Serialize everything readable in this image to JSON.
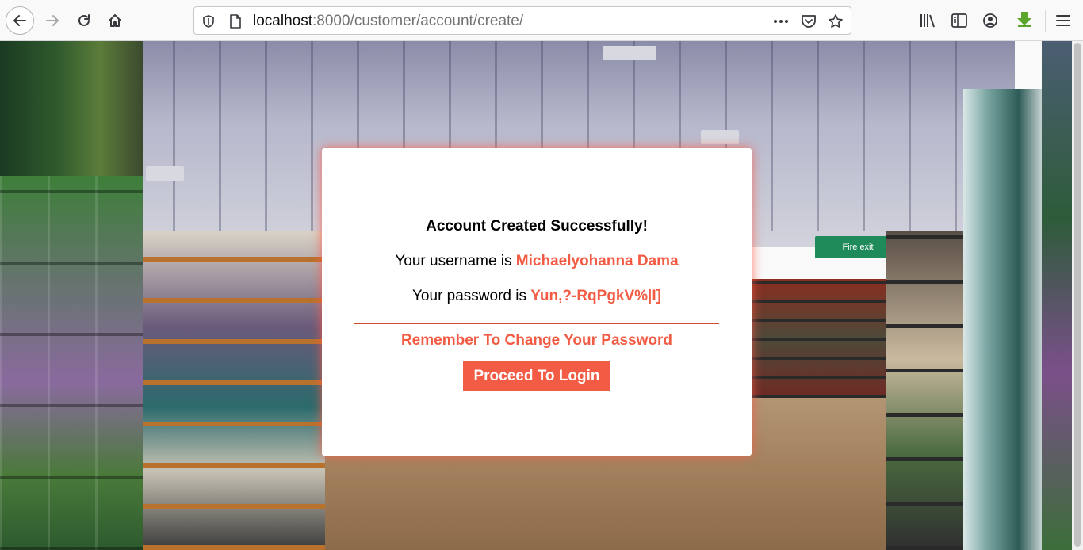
{
  "browser": {
    "url_host": "localhost",
    "url_rest": ":8000/customer/account/create/",
    "icons": {
      "back": "back-arrow-icon",
      "forward": "forward-arrow-icon",
      "reload": "reload-icon",
      "home": "home-icon",
      "shield": "tracking-shield-icon",
      "page": "page-icon",
      "more": "more-dots-icon",
      "pocket": "pocket-icon",
      "bookmark": "star-icon",
      "library": "library-icon",
      "sidebar": "sidebar-icon",
      "account": "account-icon",
      "download": "download-arrow-icon",
      "menu": "hamburger-menu-icon"
    }
  },
  "background": {
    "exit_sign": "Fire exit"
  },
  "card": {
    "title": "Account Created Successfully!",
    "username_prefix": "Your username is ",
    "username": "Michaelyohanna Dama",
    "password_prefix": "Your password is ",
    "password": "Yun,?-RqPgkV%|I]",
    "reminder": "Remember To Change Your Password",
    "login_button": "Proceed To Login"
  },
  "colors": {
    "accent": "#f25c45",
    "divider": "#d14a34"
  }
}
